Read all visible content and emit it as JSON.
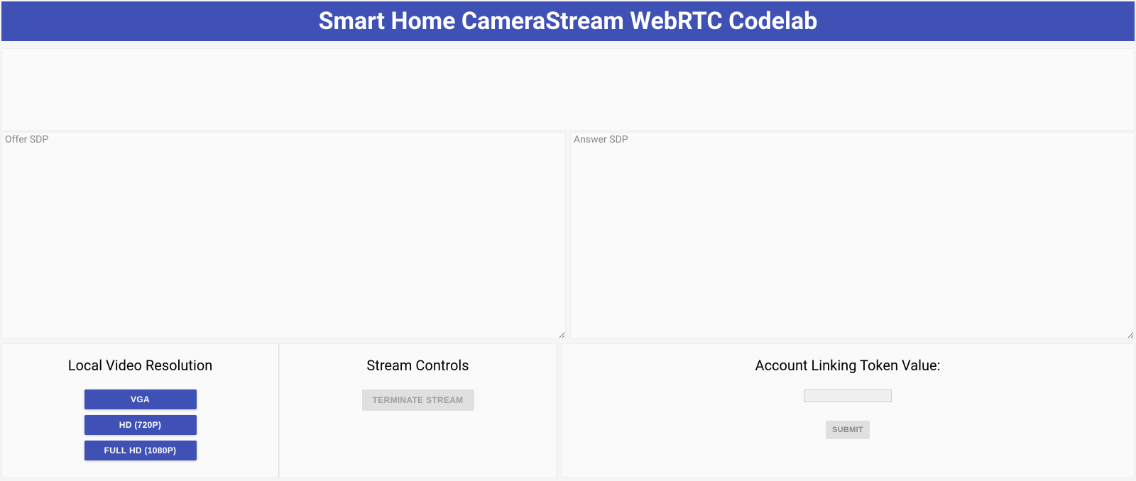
{
  "header": {
    "title": "Smart Home CameraStream WebRTC Codelab"
  },
  "sdp": {
    "offer_placeholder": "Offer SDP",
    "offer_value": "",
    "answer_placeholder": "Answer SDP",
    "answer_value": ""
  },
  "panels": {
    "resolution": {
      "title": "Local Video Resolution",
      "buttons": {
        "vga": "VGA",
        "hd": "HD (720P)",
        "fullhd": "FULL HD (1080P)"
      }
    },
    "stream": {
      "title": "Stream Controls",
      "terminate_label": "TERMINATE STREAM"
    },
    "token": {
      "title": "Account Linking Token Value:",
      "input_value": "",
      "submit_label": "SUBMIT"
    }
  }
}
